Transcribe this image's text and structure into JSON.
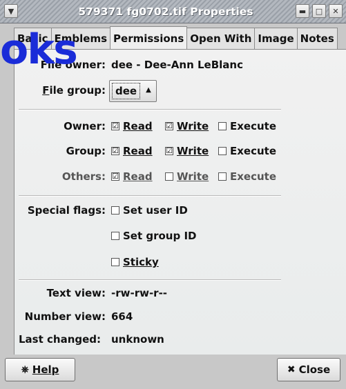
{
  "window": {
    "title": "579371 fg0702.tif Properties",
    "menu_icon": "chevron-down-icon",
    "min_icon": "minimize-icon",
    "max_icon": "maximize-icon",
    "close_icon": "close-icon"
  },
  "tabs": [
    {
      "label": "Basic"
    },
    {
      "label": "Emblems"
    },
    {
      "label": "Permissions"
    },
    {
      "label": "Open With"
    },
    {
      "label": "Image"
    },
    {
      "label": "Notes"
    }
  ],
  "owner": {
    "label": "File owner:",
    "value": "dee - Dee-Ann LeBlanc"
  },
  "group": {
    "label_u": "F",
    "label_rest": "ile group:",
    "value": "dee"
  },
  "permissions": {
    "owner": {
      "label": "Owner:",
      "read": "Read",
      "write": "Write",
      "execute": "Execute"
    },
    "group": {
      "label": "Group:",
      "read": "Read",
      "write": "Write",
      "execute": "Execute"
    },
    "others": {
      "label": "Others:",
      "read": "Read",
      "write": "Write",
      "execute": "Execute"
    },
    "check_glyph": "☑"
  },
  "special": {
    "label": "Special flags:",
    "setuid": "Set user ID",
    "setgid": "Set group ID",
    "sticky": "Sticky"
  },
  "info": {
    "text_view_label": "Text view:",
    "text_view_value": "-rw-rw-r--",
    "number_view_label": "Number view:",
    "number_view_value": "664",
    "last_changed_label": "Last changed:",
    "last_changed_value": "unknown"
  },
  "buttons": {
    "help": "Help",
    "close": "Close"
  },
  "overlay": {
    "text": "oks"
  },
  "colors": {
    "watermark": "#1a2cd8",
    "accent_bg": "#a7dcea"
  }
}
